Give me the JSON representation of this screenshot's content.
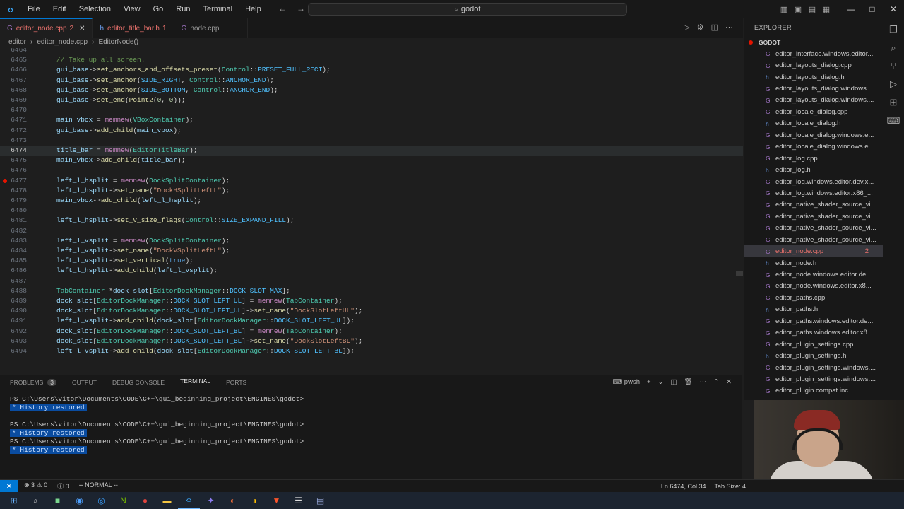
{
  "titlebar": {
    "menus": [
      "File",
      "Edit",
      "Selection",
      "View",
      "Go",
      "Run",
      "Terminal",
      "Help"
    ],
    "search": "godot",
    "logo_icon": "vscode-icon"
  },
  "tabs": [
    {
      "label": "editor_node.cpp",
      "badge": "2",
      "active": true,
      "icon": "cpp-icon"
    },
    {
      "label": "editor_title_bar.h",
      "badge": "1",
      "active": false,
      "icon": "h-icon"
    },
    {
      "label": "node.cpp",
      "badge": "",
      "active": false,
      "icon": "cpp-icon"
    }
  ],
  "breadcrumb": [
    "editor",
    "editor_node.cpp",
    "EditorNode()"
  ],
  "code_lines": [
    {
      "n": "6464",
      "code": ""
    },
    {
      "n": "6465",
      "code": "// Take up all screen."
    },
    {
      "n": "6466",
      "code": "gui_base->set_anchors_and_offsets_preset(Control::PRESET_FULL_RECT);"
    },
    {
      "n": "6467",
      "code": "gui_base->set_anchor(SIDE_RIGHT, Control::ANCHOR_END);"
    },
    {
      "n": "6468",
      "code": "gui_base->set_anchor(SIDE_BOTTOM, Control::ANCHOR_END);"
    },
    {
      "n": "6469",
      "code": "gui_base->set_end(Point2(0, 0));"
    },
    {
      "n": "6470",
      "code": ""
    },
    {
      "n": "6471",
      "code": "main_vbox = memnew(VBoxContainer);"
    },
    {
      "n": "6472",
      "code": "gui_base->add_child(main_vbox);"
    },
    {
      "n": "6473",
      "code": ""
    },
    {
      "n": "6474",
      "code": "title_bar = memnew(EditorTitleBar);"
    },
    {
      "n": "6475",
      "code": "main_vbox->add_child(title_bar);"
    },
    {
      "n": "6476",
      "code": ""
    },
    {
      "n": "6477",
      "code": "left_l_hsplit = memnew(DockSplitContainer);"
    },
    {
      "n": "6478",
      "code": "left_l_hsplit->set_name(\"DockHSplitLeftL\");"
    },
    {
      "n": "6479",
      "code": "main_vbox->add_child(left_l_hsplit);"
    },
    {
      "n": "6480",
      "code": ""
    },
    {
      "n": "6481",
      "code": "left_l_hsplit->set_v_size_flags(Control::SIZE_EXPAND_FILL);"
    },
    {
      "n": "6482",
      "code": ""
    },
    {
      "n": "6483",
      "code": "left_l_vsplit = memnew(DockSplitContainer);"
    },
    {
      "n": "6484",
      "code": "left_l_vsplit->set_name(\"DockVSplitLeftL\");"
    },
    {
      "n": "6485",
      "code": "left_l_vsplit->set_vertical(true);"
    },
    {
      "n": "6486",
      "code": "left_l_hsplit->add_child(left_l_vsplit);"
    },
    {
      "n": "6487",
      "code": ""
    },
    {
      "n": "6488",
      "code": "TabContainer *dock_slot[EditorDockManager::DOCK_SLOT_MAX];"
    },
    {
      "n": "6489",
      "code": "dock_slot[EditorDockManager::DOCK_SLOT_LEFT_UL] = memnew(TabContainer);"
    },
    {
      "n": "6490",
      "code": "dock_slot[EditorDockManager::DOCK_SLOT_LEFT_UL]->set_name(\"DockSlotLeftUL\");"
    },
    {
      "n": "6491",
      "code": "left_l_vsplit->add_child(dock_slot[EditorDockManager::DOCK_SLOT_LEFT_UL]);"
    },
    {
      "n": "6492",
      "code": "dock_slot[EditorDockManager::DOCK_SLOT_LEFT_BL] = memnew(TabContainer);"
    },
    {
      "n": "6493",
      "code": "dock_slot[EditorDockManager::DOCK_SLOT_LEFT_BL]->set_name(\"DockSlotLeftBL\");"
    },
    {
      "n": "6494",
      "code": "left_l_vsplit->add_child(dock_slot[EditorDockManager::DOCK_SLOT_LEFT_BL]);"
    }
  ],
  "current_line": "6474",
  "breakpoint_line": "6477",
  "explorer": {
    "header": "EXPLORER",
    "root": "GODOT",
    "files": [
      {
        "name": "editor_interface.windows.editor...",
        "type": "c"
      },
      {
        "name": "editor_layouts_dialog.cpp",
        "type": "c"
      },
      {
        "name": "editor_layouts_dialog.h",
        "type": "h"
      },
      {
        "name": "editor_layouts_dialog.windows....",
        "type": "c"
      },
      {
        "name": "editor_layouts_dialog.windows....",
        "type": "c"
      },
      {
        "name": "editor_locale_dialog.cpp",
        "type": "c"
      },
      {
        "name": "editor_locale_dialog.h",
        "type": "h"
      },
      {
        "name": "editor_locale_dialog.windows.e...",
        "type": "c"
      },
      {
        "name": "editor_locale_dialog.windows.e...",
        "type": "c"
      },
      {
        "name": "editor_log.cpp",
        "type": "c"
      },
      {
        "name": "editor_log.h",
        "type": "h"
      },
      {
        "name": "editor_log.windows.editor.dev.x...",
        "type": "c"
      },
      {
        "name": "editor_log.windows.editor.x86_...",
        "type": "c"
      },
      {
        "name": "editor_native_shader_source_vi...",
        "type": "c"
      },
      {
        "name": "editor_native_shader_source_vi...",
        "type": "c"
      },
      {
        "name": "editor_native_shader_source_vi...",
        "type": "c"
      },
      {
        "name": "editor_native_shader_source_vi...",
        "type": "c"
      },
      {
        "name": "editor_node.cpp",
        "type": "c",
        "active": true,
        "badge": "2"
      },
      {
        "name": "editor_node.h",
        "type": "h"
      },
      {
        "name": "editor_node.windows.editor.de...",
        "type": "c"
      },
      {
        "name": "editor_node.windows.editor.x8...",
        "type": "c"
      },
      {
        "name": "editor_paths.cpp",
        "type": "c"
      },
      {
        "name": "editor_paths.h",
        "type": "h"
      },
      {
        "name": "editor_paths.windows.editor.de...",
        "type": "c"
      },
      {
        "name": "editor_paths.windows.editor.x8...",
        "type": "c"
      },
      {
        "name": "editor_plugin_settings.cpp",
        "type": "c"
      },
      {
        "name": "editor_plugin_settings.h",
        "type": "h"
      },
      {
        "name": "editor_plugin_settings.windows....",
        "type": "c"
      },
      {
        "name": "editor_plugin_settings.windows....",
        "type": "c"
      },
      {
        "name": "editor_plugin.compat.inc",
        "type": "c"
      }
    ]
  },
  "panel": {
    "tabs": [
      "PROBLEMS",
      "OUTPUT",
      "DEBUG CONSOLE",
      "TERMINAL",
      "PORTS"
    ],
    "problems_count": "3",
    "active_tab": "TERMINAL",
    "shell": "pwsh",
    "terminal": [
      {
        "prompt": "PS C:\\Users\\vitor\\Documents\\CODE\\C++\\gui_beginning_project\\ENGINES\\godot>",
        "note": "* History restored"
      },
      {
        "prompt": "PS C:\\Users\\vitor\\Documents\\CODE\\C++\\gui_beginning_project\\ENGINES\\godot>",
        "note": "* History restored"
      },
      {
        "prompt": "PS C:\\Users\\vitor\\Documents\\CODE\\C++\\gui_beginning_project\\ENGINES\\godot>",
        "note": "* History restored"
      }
    ]
  },
  "statusbar": {
    "errors": "3",
    "warnings": "0",
    "info": "0",
    "mode": "-- NORMAL --",
    "position": "Ln 6474, Col 34",
    "indent": "Tab Size: 4"
  },
  "colors": {
    "accent": "#0078d4",
    "error": "#e8716c",
    "breakpoint": "#e51400"
  }
}
